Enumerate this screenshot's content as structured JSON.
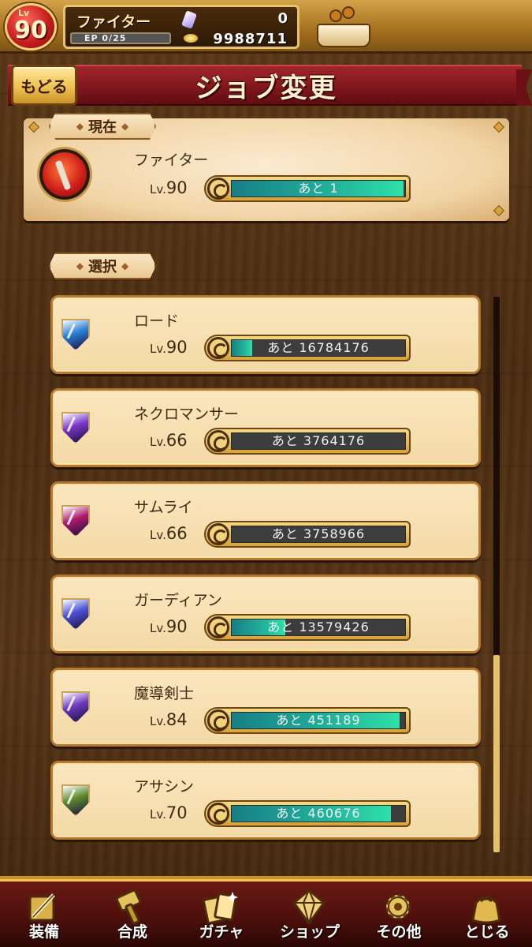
{
  "player": {
    "lv_tag": "Lv",
    "level": "90",
    "job_name": "ファイター",
    "ep": "EP 0/25",
    "gems": "0",
    "gold": "9988711"
  },
  "header": {
    "back_label": "もどる",
    "title": "ジョブ変更"
  },
  "current": {
    "section_label": "現在",
    "job": {
      "name": "ファイター",
      "lv_prefix": "Lv.",
      "level": "90",
      "remaining": "あと 1",
      "progress": 0.99
    }
  },
  "selection": {
    "section_label": "選択",
    "jobs": [
      {
        "name": "ロード",
        "lv_prefix": "Lv.",
        "level": "90",
        "remaining": "あと 16784176",
        "progress": 0.12,
        "icon": "lord-icon",
        "color": "#2a7fd6"
      },
      {
        "name": "ネクロマンサー",
        "lv_prefix": "Lv.",
        "level": "66",
        "remaining": "あと 3764176",
        "progress": 0.0,
        "icon": "necromancer-icon",
        "color": "#7a36c8"
      },
      {
        "name": "サムライ",
        "lv_prefix": "Lv.",
        "level": "66",
        "remaining": "あと 3758966",
        "progress": 0.0,
        "icon": "samurai-icon",
        "color": "#b0186a"
      },
      {
        "name": "ガーディアン",
        "lv_prefix": "Lv.",
        "level": "90",
        "remaining": "あと 13579426",
        "progress": 0.31,
        "icon": "guardian-icon",
        "color": "#4c52d6"
      },
      {
        "name": "魔導剣士",
        "lv_prefix": "Lv.",
        "level": "84",
        "remaining": "あと 451189",
        "progress": 0.97,
        "icon": "magic-swordsman-icon",
        "color": "#6d3ac0"
      },
      {
        "name": "アサシン",
        "lv_prefix": "Lv.",
        "level": "70",
        "remaining": "あと 460676",
        "progress": 0.92,
        "icon": "assassin-icon",
        "color": "#5d8a2c"
      }
    ]
  },
  "nav": [
    {
      "label": "装備",
      "icon": "equipment-icon"
    },
    {
      "label": "合成",
      "icon": "hammer-icon"
    },
    {
      "label": "ガチャ",
      "icon": "gacha-icon"
    },
    {
      "label": "ショップ",
      "icon": "crystal-shop-icon"
    },
    {
      "label": "その他",
      "icon": "gear-icon"
    },
    {
      "label": "とじる",
      "icon": "close-bag-icon"
    }
  ]
}
